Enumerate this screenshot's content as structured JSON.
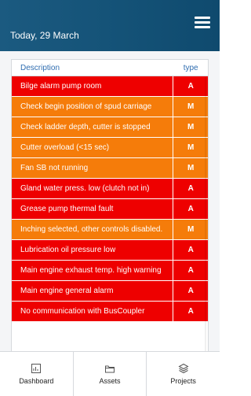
{
  "header": {
    "date": "Today, 29 March",
    "menu_icon": "hamburger-menu-icon"
  },
  "table": {
    "columns": {
      "description": "Description",
      "type": "type"
    },
    "rows": [
      {
        "description": "Bilge alarm pump room",
        "type": "A",
        "color": "#ee0000"
      },
      {
        "description": "Check begin position of spud carriage",
        "type": "M",
        "color": "#f57c0a"
      },
      {
        "description": "Check ladder depth, cutter is stopped",
        "type": "M",
        "color": "#f57c0a"
      },
      {
        "description": "Cutter overload (<15 sec)",
        "type": "M",
        "color": "#f57c0a"
      },
      {
        "description": "Fan SB not running",
        "type": "M",
        "color": "#f57c0a"
      },
      {
        "description": "Gland water press. low (clutch not in)",
        "type": "A",
        "color": "#ee0000"
      },
      {
        "description": "Grease pump thermal fault",
        "type": "A",
        "color": "#ee0000"
      },
      {
        "description": "Inching selected, other controls disabled.",
        "type": "M",
        "color": "#f57c0a"
      },
      {
        "description": "Lubrication oil pressure low",
        "type": "A",
        "color": "#ee0000"
      },
      {
        "description": "Main engine exhaust temp. high warning",
        "type": "A",
        "color": "#ee0000"
      },
      {
        "description": "Main engine general alarm",
        "type": "A",
        "color": "#ee0000"
      },
      {
        "description": "No communication with BusCoupler",
        "type": "A",
        "color": "#ee0000"
      }
    ]
  },
  "bottom_nav": {
    "items": [
      {
        "label": "Dashboard",
        "icon": "dashboard-icon"
      },
      {
        "label": "Assets",
        "icon": "folder-icon"
      },
      {
        "label": "Projects",
        "icon": "layers-icon"
      }
    ]
  },
  "colors": {
    "header_bg": "#145277",
    "alarm_red": "#ee0000",
    "message_orange": "#f57c0a",
    "column_header_blue": "#2f6db0"
  }
}
